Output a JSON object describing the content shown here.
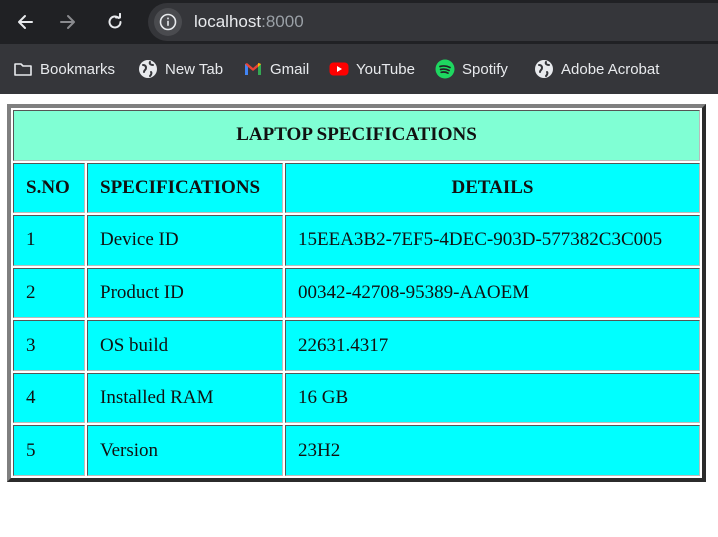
{
  "browser": {
    "url_host": "localhost",
    "url_port": ":8000"
  },
  "bookmarks": [
    {
      "label": "Bookmarks",
      "icon": "folder-icon"
    },
    {
      "label": "New Tab",
      "icon": "globe-icon"
    },
    {
      "label": "Gmail",
      "icon": "gmail-icon"
    },
    {
      "label": "YouTube",
      "icon": "youtube-icon"
    },
    {
      "label": "Spotify",
      "icon": "spotify-icon"
    },
    {
      "label": "Adobe Acrobat",
      "icon": "globe-icon"
    }
  ],
  "table": {
    "title": "LAPTOP SPECIFICATIONS",
    "headers": [
      "S.NO",
      "SPECIFICATIONS",
      "DETAILS"
    ],
    "rows": [
      [
        "1",
        "Device ID",
        "15EEA3B2-7EF5-4DEC-903D-577382C3C005"
      ],
      [
        "2",
        "Product ID",
        "00342-42708-95389-AAOEM"
      ],
      [
        "3",
        "OS build",
        "22631.4317"
      ],
      [
        "4",
        "Installed RAM",
        "16 GB"
      ],
      [
        "5",
        "Version",
        "23H2"
      ]
    ]
  },
  "colors": {
    "title_bg": "#80ffd4",
    "cell_bg": "#00ffff",
    "chrome_bg": "#202124"
  }
}
